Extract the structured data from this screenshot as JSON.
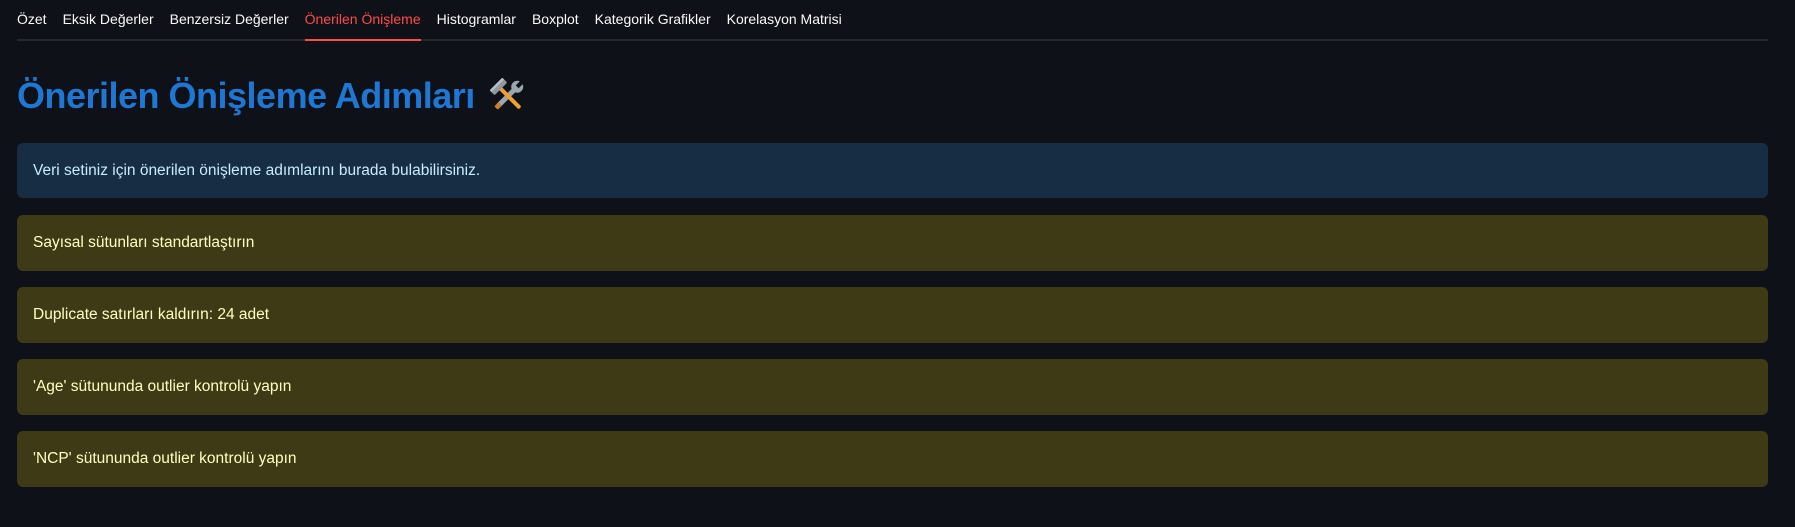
{
  "tabs": [
    {
      "label": "Özet",
      "active": false
    },
    {
      "label": "Eksik Değerler",
      "active": false
    },
    {
      "label": "Benzersiz Değerler",
      "active": false
    },
    {
      "label": "Önerilen Önişleme",
      "active": true
    },
    {
      "label": "Histogramlar",
      "active": false
    },
    {
      "label": "Boxplot",
      "active": false
    },
    {
      "label": "Kategorik Grafikler",
      "active": false
    },
    {
      "label": "Korelasyon Matrisi",
      "active": false
    }
  ],
  "main": {
    "title": "Önerilen Önişleme Adımları",
    "title_icon": "hammer-and-wrench-icon",
    "info_message": "Veri setiniz için önerilen önişleme adımlarını burada bulabilirsiniz.",
    "suggestions": [
      "Sayısal sütunları standartlaştırın",
      "Duplicate satırları kaldırın: 24 adet",
      "'Age' sütununda outlier kontrolü yapın",
      "'NCP' sütununda outlier kontrolü yapın"
    ]
  },
  "colors": {
    "accent_tab": "#ff4b4b",
    "title": "#1f77d4",
    "info_bg": "#172d43",
    "warning_bg": "#3e3a16"
  }
}
